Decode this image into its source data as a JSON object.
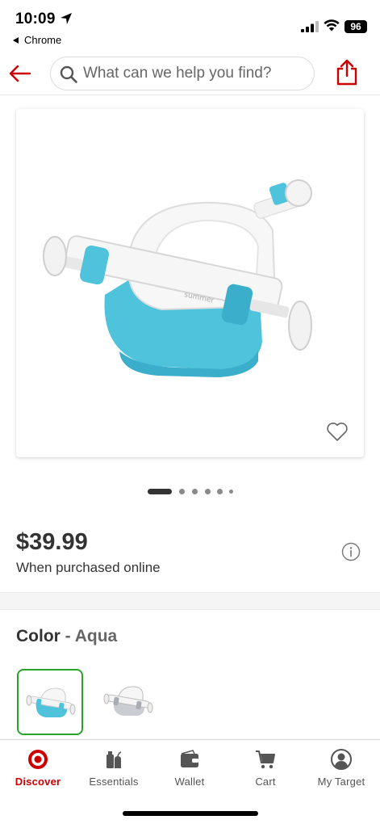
{
  "status_bar": {
    "time": "10:09",
    "back_app": "Chrome",
    "battery": "96"
  },
  "header": {
    "search_placeholder": "What can we help you find?",
    "icons": [
      "back-arrow-icon",
      "search-icon",
      "share-icon"
    ]
  },
  "product": {
    "image": "bath seat aqua",
    "image_index": 1,
    "image_count": 6,
    "price": "$39.99",
    "price_note": "When purchased online"
  },
  "color": {
    "label": "Color",
    "separator": " - ",
    "value": "Aqua",
    "swatches": [
      "Aqua",
      "Gray"
    ]
  },
  "nav": {
    "items": [
      {
        "label": "Discover",
        "icon": "target-bullseye-icon",
        "active": true
      },
      {
        "label": "Essentials",
        "icon": "essentials-icon",
        "active": false
      },
      {
        "label": "Wallet",
        "icon": "wallet-icon",
        "active": false
      },
      {
        "label": "Cart",
        "icon": "cart-icon",
        "active": false
      },
      {
        "label": "My Target",
        "icon": "account-icon",
        "active": false
      }
    ]
  },
  "colors": {
    "brand_red": "#cc0000",
    "text_primary": "#333333",
    "selected_swatch_border": "#29a329",
    "aqua": "#4fc3dc"
  }
}
